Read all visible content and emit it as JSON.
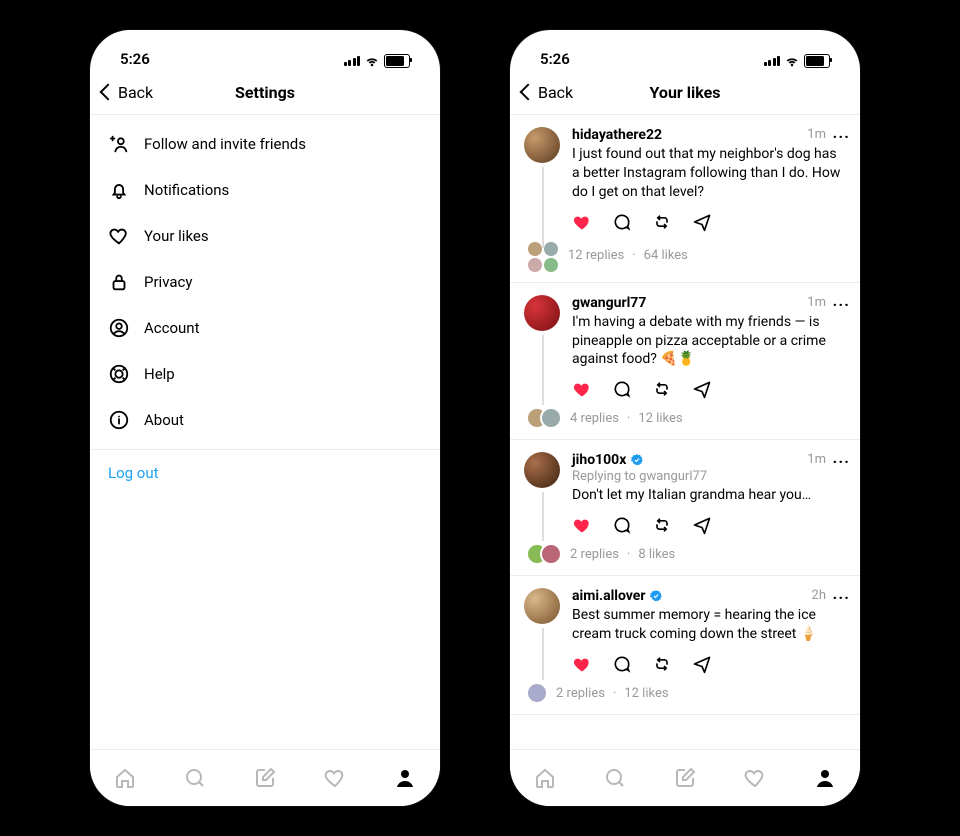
{
  "status": {
    "time": "5:26"
  },
  "nav": {
    "back": "Back",
    "settings_title": "Settings",
    "likes_title": "Your likes"
  },
  "menu": {
    "follow": "Follow and invite friends",
    "notifications": "Notifications",
    "your_likes": "Your likes",
    "privacy": "Privacy",
    "account": "Account",
    "help": "Help",
    "about": "About",
    "logout": "Log out"
  },
  "posts": [
    {
      "user": "hidayathere22",
      "verified": false,
      "time": "1m",
      "text": "I just found out that my neighbor's dog has a better Instagram following than I do. How do I get on that level?",
      "replies": "12 replies",
      "likes": "64 likes"
    },
    {
      "user": "gwangurl77",
      "verified": false,
      "time": "1m",
      "text": "I'm having a debate with my friends — is pineapple on pizza acceptable or a crime against food? 🍕🍍",
      "replies": "4 replies",
      "likes": "12 likes"
    },
    {
      "user": "jiho100x",
      "verified": true,
      "time": "1m",
      "replying": "Replying to gwangurl77",
      "text": "Don't let my Italian grandma hear you…",
      "replies": "2 replies",
      "likes": "8 likes"
    },
    {
      "user": "aimi.allover",
      "verified": true,
      "time": "2h",
      "text": "Best summer memory = hearing the ice cream truck coming down the street 🍦",
      "replies": "2 replies",
      "likes": "12 likes"
    }
  ]
}
